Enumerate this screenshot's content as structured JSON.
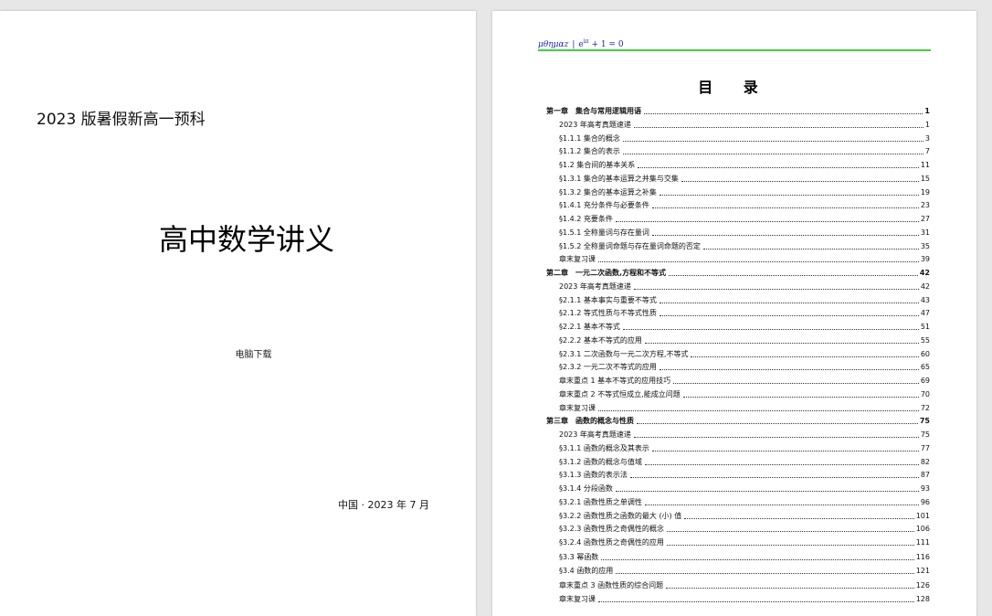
{
  "left_page": {
    "subtitle": "2023 版暑假新高一预科",
    "title": "高中数学讲义",
    "download": "电脑下载",
    "location_date": "中国 · 2023 年 7 月"
  },
  "right_page": {
    "running_head": {
      "greek": "μθημαz",
      "separator": "|",
      "formula_base": "e",
      "formula_exp": "iπ",
      "formula_rest": " + 1 = 0"
    },
    "toc_title": "目 录",
    "toc": [
      {
        "label": "第一章　集合与常用逻辑用语",
        "page": "1",
        "level": "chapter"
      },
      {
        "label": "2023 年高考真题速递",
        "page": "1",
        "level": "section"
      },
      {
        "label": "§1.1.1  集合的概念",
        "page": "3",
        "level": "section"
      },
      {
        "label": "§1.1.2  集合的表示",
        "page": "7",
        "level": "section"
      },
      {
        "label": "§1.2  集合间的基本关系",
        "page": "11",
        "level": "section"
      },
      {
        "label": "§1.3.1  集合的基本运算之并集与交集",
        "page": "15",
        "level": "section"
      },
      {
        "label": "§1.3.2  集合的基本运算之补集",
        "page": "19",
        "level": "section"
      },
      {
        "label": "§1.4.1  充分条件与必要条件",
        "page": "23",
        "level": "section"
      },
      {
        "label": "§1.4.2  充要条件",
        "page": "27",
        "level": "section"
      },
      {
        "label": "§1.5.1  全称量词与存在量词",
        "page": "31",
        "level": "section"
      },
      {
        "label": "§1.5.2  全称量词命题与存在量词命题的否定",
        "page": "35",
        "level": "section"
      },
      {
        "label": "章末复习课",
        "page": "39",
        "level": "section"
      },
      {
        "label": "第二章　一元二次函数,方程和不等式",
        "page": "42",
        "level": "chapter"
      },
      {
        "label": "2023 年高考真题速递",
        "page": "42",
        "level": "section"
      },
      {
        "label": "§2.1.1  基本事实与重要不等式",
        "page": "43",
        "level": "section"
      },
      {
        "label": "§2.1.2  等式性质与不等式性质",
        "page": "47",
        "level": "section"
      },
      {
        "label": "§2.2.1  基本不等式",
        "page": "51",
        "level": "section"
      },
      {
        "label": "§2.2.2  基本不等式的应用",
        "page": "55",
        "level": "section"
      },
      {
        "label": "§2.3.1  二次函数与一元二次方程,不等式",
        "page": "60",
        "level": "section"
      },
      {
        "label": "§2.3.2  一元二次不等式的应用",
        "page": "65",
        "level": "section"
      },
      {
        "label": "章末重点 1  基本不等式的应用技巧",
        "page": "69",
        "level": "section"
      },
      {
        "label": "章末重点 2  不等式恒成立,能成立问题",
        "page": "70",
        "level": "section"
      },
      {
        "label": "章末复习课",
        "page": "72",
        "level": "section"
      },
      {
        "label": "第三章　函数的概念与性质",
        "page": "75",
        "level": "chapter"
      },
      {
        "label": "2023 年高考真题速递",
        "page": "75",
        "level": "section"
      },
      {
        "label": "§3.1.1  函数的概念及其表示",
        "page": "77",
        "level": "section"
      },
      {
        "label": "§3.1.2  函数的概念与值域",
        "page": "82",
        "level": "section"
      },
      {
        "label": "§3.1.3  函数的表示法",
        "page": "87",
        "level": "section"
      },
      {
        "label": "§3.1.4  分段函数",
        "page": "93",
        "level": "section"
      },
      {
        "label": "§3.2.1  函数性质之单调性",
        "page": "96",
        "level": "section"
      },
      {
        "label": "§3.2.2  函数性质之函数的最大 (小) 值",
        "page": "101",
        "level": "section"
      },
      {
        "label": "§3.2.3  函数性质之奇偶性的概念",
        "page": "106",
        "level": "section"
      },
      {
        "label": "§3.2.4  函数性质之奇偶性的应用",
        "page": "111",
        "level": "section"
      },
      {
        "label": "§3.3  幂函数",
        "page": "116",
        "level": "section"
      },
      {
        "label": "§3.4  函数的应用",
        "page": "121",
        "level": "section"
      },
      {
        "label": "章末重点 3  函数性质的综合问题",
        "page": "126",
        "level": "section"
      },
      {
        "label": "章末复习课",
        "page": "128",
        "level": "section"
      }
    ]
  },
  "colors": {
    "background": "#e7e7e7",
    "page": "#ffffff",
    "running_head": "#1e24b8",
    "head_rule": "#3ecf3e"
  }
}
